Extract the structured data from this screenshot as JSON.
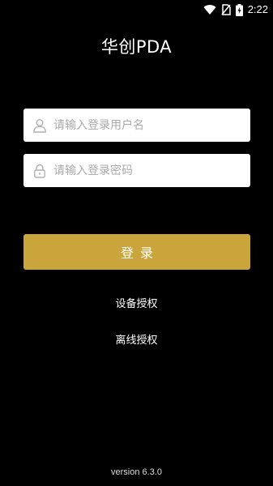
{
  "status_bar": {
    "time": "2:22",
    "icons": [
      "wifi-icon",
      "no-sim-icon",
      "battery-charging-icon"
    ]
  },
  "app": {
    "title": "华创PDA"
  },
  "login_form": {
    "username_placeholder": "请输入登录用户名",
    "username_value": "",
    "username_icon": "user-icon",
    "password_placeholder": "请输入登录密码",
    "password_value": "",
    "password_icon": "lock-icon",
    "login_label": "登录"
  },
  "links": {
    "device_auth": "设备授权",
    "offline_auth": "离线授权"
  },
  "footer": {
    "version": "version 6.3.0"
  },
  "colors": {
    "background": "#000000",
    "accent": "#c9a53c",
    "field_background": "#ffffff",
    "placeholder": "#a9a9a9"
  }
}
